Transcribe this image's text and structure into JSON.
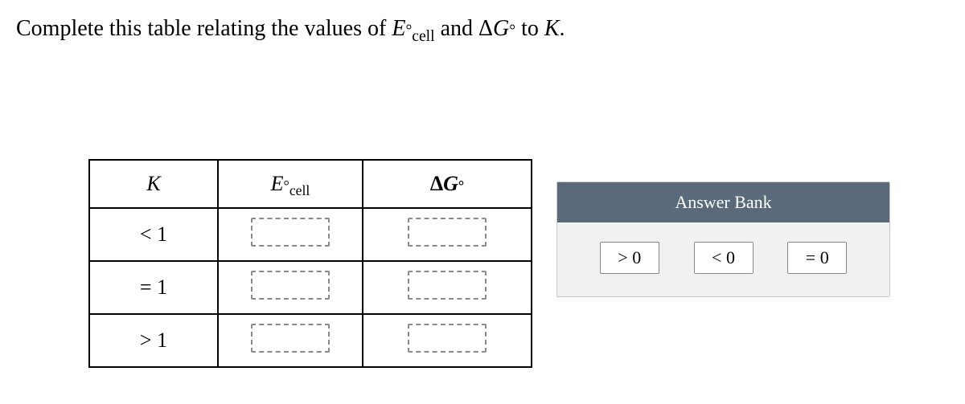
{
  "prompt": {
    "pre": "Complete this table relating the values of ",
    "e_sym": "E",
    "e_sub": "cell",
    "e_sup": "°",
    "mid": " and Δ",
    "g_sym": "G",
    "g_sup": "°",
    "post": " to ",
    "k_sym": "K",
    "end": "."
  },
  "table": {
    "headers": {
      "k": "K",
      "e_sym": "E",
      "e_sub": "cell",
      "e_sup": "°",
      "g_pre": "Δ",
      "g_sym": "G",
      "g_sup": "°"
    },
    "rows": [
      {
        "k": "< 1"
      },
      {
        "k": "= 1"
      },
      {
        "k": "> 1"
      }
    ]
  },
  "answer_bank": {
    "title": "Answer Bank",
    "tiles": [
      "> 0",
      "< 0",
      "= 0"
    ]
  }
}
